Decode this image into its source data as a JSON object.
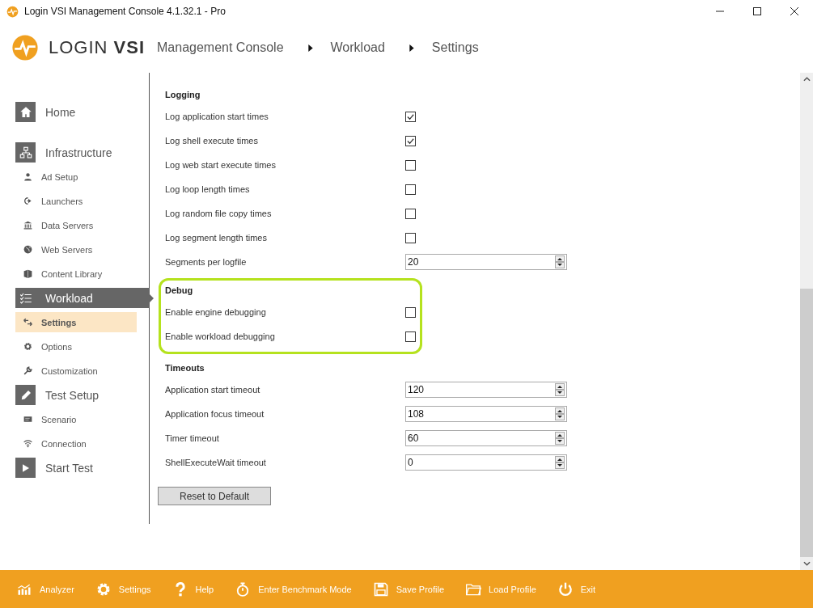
{
  "window": {
    "title": "Login VSI Management Console 4.1.32.1 - Pro"
  },
  "header": {
    "logo_light": "LOGIN",
    "logo_bold": "VSI",
    "breadcrumb": [
      "Management Console",
      "Workload",
      "Settings"
    ]
  },
  "sidebar": {
    "items": [
      {
        "kind": "section",
        "label": "Home",
        "selected": false
      },
      {
        "kind": "section",
        "label": "Infrastructure",
        "selected": false
      },
      {
        "kind": "item",
        "label": "Ad Setup",
        "selected": false
      },
      {
        "kind": "item",
        "label": "Launchers",
        "selected": false
      },
      {
        "kind": "item",
        "label": "Data Servers",
        "selected": false
      },
      {
        "kind": "item",
        "label": "Web Servers",
        "selected": false
      },
      {
        "kind": "item",
        "label": "Content Library",
        "selected": false
      },
      {
        "kind": "section",
        "label": "Workload",
        "selected": true
      },
      {
        "kind": "item",
        "label": "Settings",
        "selected": true
      },
      {
        "kind": "item",
        "label": "Options",
        "selected": false
      },
      {
        "kind": "item",
        "label": "Customization",
        "selected": false
      },
      {
        "kind": "section",
        "label": "Test Setup",
        "selected": false
      },
      {
        "kind": "item",
        "label": "Scenario",
        "selected": false
      },
      {
        "kind": "item",
        "label": "Connection",
        "selected": false
      },
      {
        "kind": "section",
        "label": "Start Test",
        "selected": false
      }
    ]
  },
  "sections": [
    {
      "title": "Logging",
      "highlighted": false,
      "rows": [
        {
          "kind": "checkbox",
          "label": "Log application start times",
          "checked": true
        },
        {
          "kind": "checkbox",
          "label": "Log shell execute times",
          "checked": true
        },
        {
          "kind": "checkbox",
          "label": "Log web start execute times",
          "checked": false
        },
        {
          "kind": "checkbox",
          "label": "Log loop length times",
          "checked": false
        },
        {
          "kind": "checkbox",
          "label": "Log random file copy times",
          "checked": false
        },
        {
          "kind": "checkbox",
          "label": "Log segment length times",
          "checked": false
        },
        {
          "kind": "spinner",
          "label": "Segments per logfile",
          "value": "20"
        }
      ]
    },
    {
      "title": "Debug",
      "highlighted": true,
      "rows": [
        {
          "kind": "checkbox",
          "label": "Enable engine debugging",
          "checked": false
        },
        {
          "kind": "checkbox",
          "label": "Enable workload debugging",
          "checked": false
        }
      ]
    },
    {
      "title": "Timeouts",
      "highlighted": false,
      "rows": [
        {
          "kind": "spinner",
          "label": "Application start timeout",
          "value": "120"
        },
        {
          "kind": "spinner",
          "label": "Application focus timeout",
          "value": "108"
        },
        {
          "kind": "spinner",
          "label": "Timer timeout",
          "value": "60"
        },
        {
          "kind": "spinner",
          "label": "ShellExecuteWait timeout",
          "value": "0"
        }
      ]
    }
  ],
  "reset_button": "Reset to Default",
  "footer": [
    {
      "label": "Analyzer"
    },
    {
      "label": "Settings"
    },
    {
      "label": "Help"
    },
    {
      "label": "Enter Benchmark Mode"
    },
    {
      "label": "Save Profile"
    },
    {
      "label": "Load Profile"
    },
    {
      "label": "Exit"
    }
  ]
}
